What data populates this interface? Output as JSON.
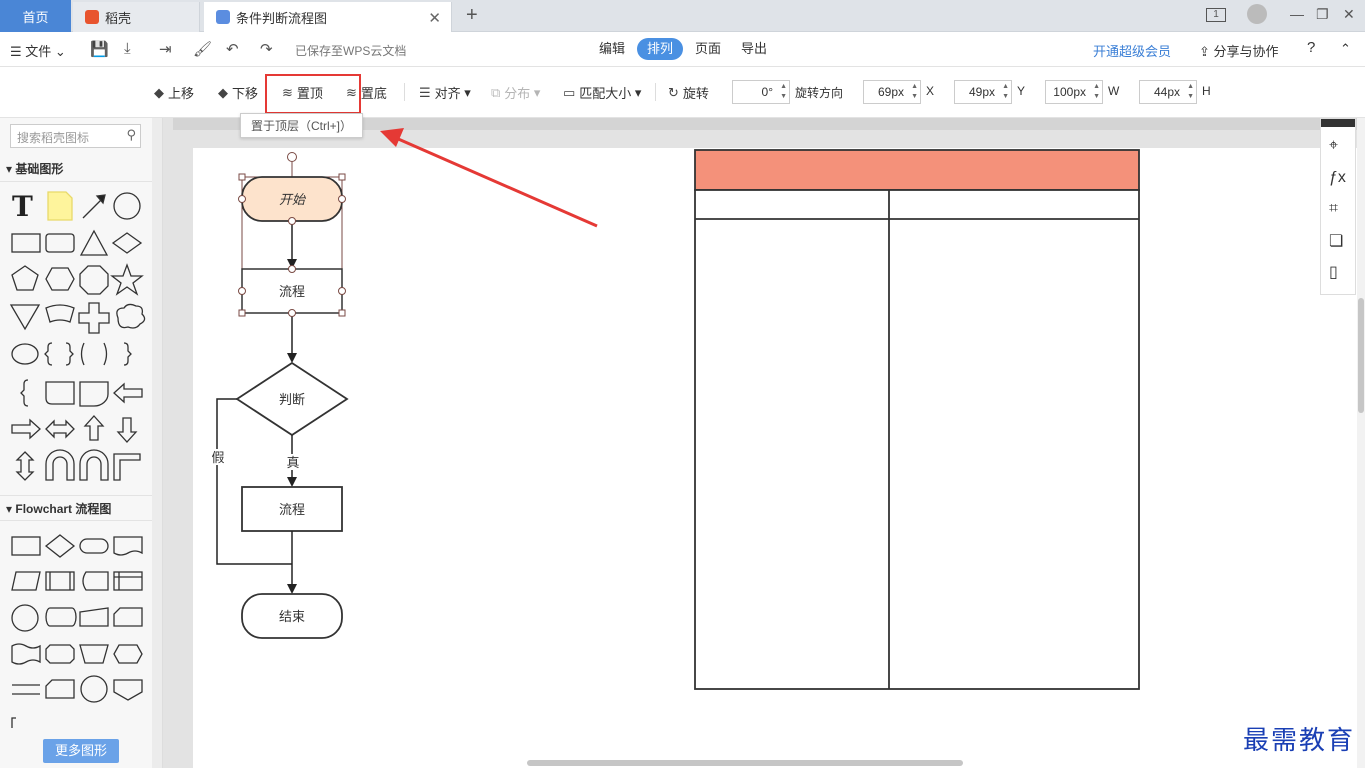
{
  "tabs": {
    "home": "首页",
    "daoke": "稻壳",
    "doc": "条件判断流程图"
  },
  "menubar": {
    "file": "文件",
    "saved": "已保存至WPS云文档",
    "tabs": [
      "编辑",
      "排列",
      "页面",
      "导出"
    ],
    "active_tab": "排列",
    "vip": "开通超级会员",
    "share": "分享与协作",
    "help": "?"
  },
  "arrange": {
    "move_up": "上移",
    "move_down": "下移",
    "to_top": "置顶",
    "to_bottom": "置底",
    "align": "对齐",
    "distribute": "分布",
    "match_size": "匹配大小",
    "rotate": "旋转",
    "angle": "0°",
    "rotate_dir": "旋转方向",
    "x_value": "69px",
    "x_label": "X",
    "y_value": "49px",
    "y_label": "Y",
    "w_value": "100px",
    "w_label": "W",
    "h_value": "44px",
    "h_label": "H",
    "tooltip": "置于顶层（Ctrl+]）"
  },
  "leftpanel": {
    "search_placeholder": "搜索稻壳图标",
    "section_basic": "基础图形",
    "section_flowchart": "Flowchart 流程图",
    "more_shapes": "更多图形"
  },
  "flowchart": {
    "start": "开始",
    "process1": "流程",
    "decision": "判断",
    "true_label": "真",
    "false_label": "假",
    "process2": "流程",
    "end": "结束"
  },
  "colors": {
    "accent": "#4a90e2",
    "start_fill": "#fde3cc",
    "table_header": "#f4917a",
    "highlight": "#e53935"
  },
  "watermark": "最需教育"
}
